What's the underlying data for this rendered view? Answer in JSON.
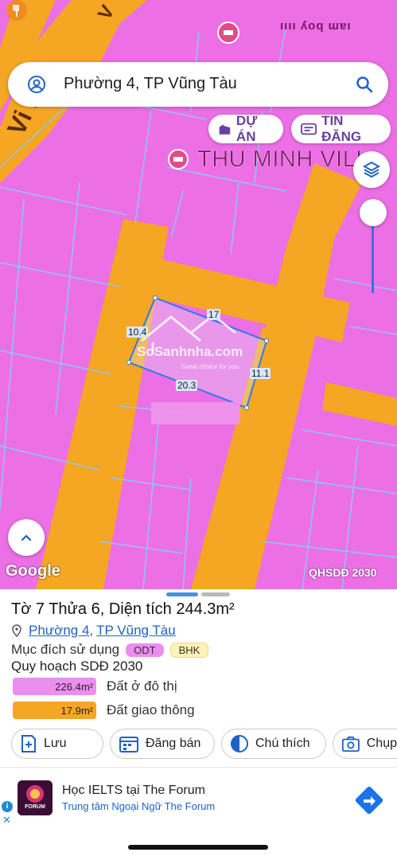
{
  "map": {
    "top_poi_text": "ıııı ʎoq ɯɐı",
    "road_label": "Vi D",
    "road_label_short": "V",
    "poi_name": "THU MINH VILL",
    "parcel_dims": {
      "top": "17",
      "left": "10.4",
      "right": "11.1",
      "bottom": "20.3"
    },
    "watermark": "SoSanhnha.com",
    "watermark_sub": "Great choice for you",
    "google": "Google",
    "layer_badge": "QHSDĐ 2030",
    "colors": {
      "residential": "#ec6fe6",
      "road": "#f5a623",
      "parcel_line": "#2e7be6",
      "lot_lines": "#8fc6f0"
    },
    "icons": [
      "restaurant-icon",
      "hotel-icon",
      "layers-icon",
      "chevron-up-icon"
    ]
  },
  "search": {
    "query": "Phường 4, TP Vũng Tàu",
    "left_icon": "user-icon",
    "right_icon": "search-icon"
  },
  "chips": {
    "du_an": "DỰ ÁN",
    "tin_dang": "TIN ĐĂNG"
  },
  "sheet": {
    "title": "Tờ 7 Thửa 6, Diện tích 244.3m²",
    "ward": "Phường 4",
    "separator": ",",
    "city": "TP Vũng Tàu",
    "purpose_label": "Mục đích sử dụng",
    "tags": [
      "ODT",
      "BHK"
    ],
    "plan_title": "Quy hoạch SDĐ 2030",
    "plan_items": [
      {
        "area": "226.4m²",
        "label": "Đất ở đô thị",
        "color": "#ec8ef0"
      },
      {
        "area": "17.9m²",
        "label": "Đất giao thông",
        "color": "#f5a623"
      }
    ],
    "actions": [
      {
        "label": "Lưu",
        "icon": "add-bookmark-icon"
      },
      {
        "label": "Đăng bán",
        "icon": "calendar-icon"
      },
      {
        "label": "Chú thích",
        "icon": "contrast-icon"
      },
      {
        "label": "Chụp",
        "icon": "camera-icon"
      }
    ]
  },
  "ad": {
    "logo_text": "FORUM",
    "title": "Học IELTS tại The Forum",
    "subtitle": "Trung tâm Ngoại Ngữ The Forum",
    "info": "i",
    "close": "✕"
  }
}
